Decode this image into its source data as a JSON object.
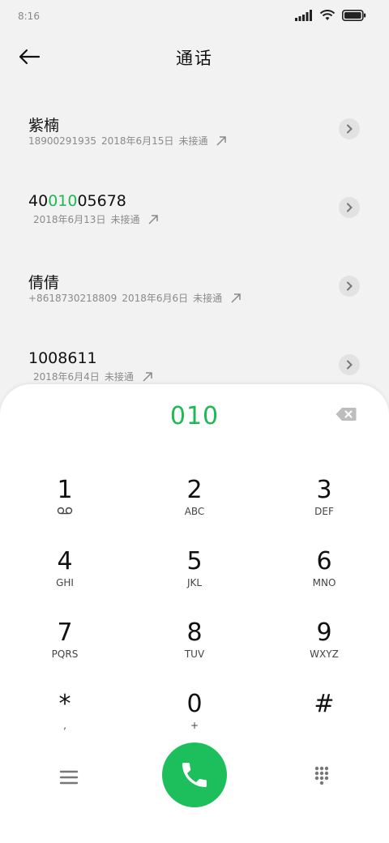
{
  "status_bar": {
    "time": "8:16"
  },
  "header": {
    "title": "通话"
  },
  "calls": [
    {
      "name_pre": "紫楠",
      "name_hl": "",
      "name_post": "",
      "number": "18900291935",
      "date": "2018年6月15日",
      "status": "未接通"
    },
    {
      "name_pre": "40",
      "name_hl": "010",
      "name_post": "05678",
      "number": "",
      "date": "2018年6月13日",
      "status": "未接通"
    },
    {
      "name_pre": "倩倩",
      "name_hl": "",
      "name_post": "",
      "number": "+8618730218809",
      "date": "2018年6月6日",
      "status": "未接通"
    },
    {
      "name_pre": "1008611",
      "name_hl": "",
      "name_post": "",
      "number": "",
      "date": "2018年6月4日",
      "status": "未接通"
    }
  ],
  "dialer": {
    "dialed": "010",
    "keys": [
      {
        "digit": "1",
        "sub": ""
      },
      {
        "digit": "2",
        "sub": "ABC"
      },
      {
        "digit": "3",
        "sub": "DEF"
      },
      {
        "digit": "4",
        "sub": "GHI"
      },
      {
        "digit": "5",
        "sub": "JKL"
      },
      {
        "digit": "6",
        "sub": "MNO"
      },
      {
        "digit": "7",
        "sub": "PQRS"
      },
      {
        "digit": "8",
        "sub": "TUV"
      },
      {
        "digit": "9",
        "sub": "WXYZ"
      },
      {
        "digit": "*",
        "sub": ","
      },
      {
        "digit": "0",
        "sub": "+"
      },
      {
        "digit": "#",
        "sub": ""
      }
    ]
  },
  "colors": {
    "accent": "#1db954",
    "call_button": "#1cbf5b"
  }
}
